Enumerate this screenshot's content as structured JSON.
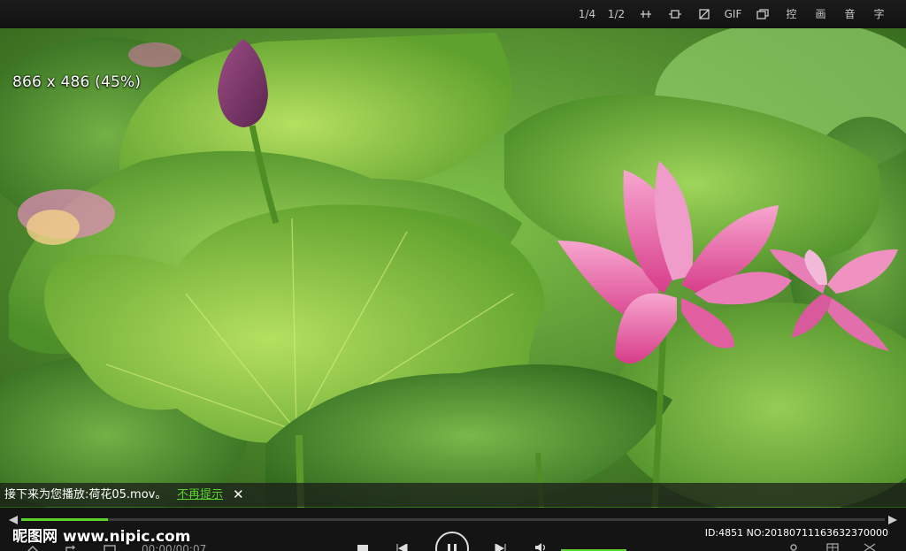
{
  "toolbar": {
    "items": [
      {
        "name": "quarter-size",
        "label": "1/4"
      },
      {
        "name": "half-size",
        "label": "1/2"
      },
      {
        "name": "crop-h",
        "label": ""
      },
      {
        "name": "crop-box",
        "label": ""
      },
      {
        "name": "rotate",
        "label": ""
      },
      {
        "name": "gif",
        "label": "GIF"
      },
      {
        "name": "windows",
        "label": ""
      },
      {
        "name": "control",
        "label": "控"
      },
      {
        "name": "picture",
        "label": "画"
      },
      {
        "name": "audio",
        "label": "音"
      },
      {
        "name": "subtitle",
        "label": "字"
      }
    ]
  },
  "video": {
    "resolution_label": "866 x 486 (45%)"
  },
  "notice": {
    "message": "接下来为您播放:荷花05.mov。",
    "dismiss_link": "不再提示",
    "close_glyph": "✕"
  },
  "bottom": {
    "watermark_brand": "昵图网",
    "watermark_url": "www.nipic.com",
    "image_id": "ID:4851 NO:20180711163632370000",
    "time": "00:00/00:07",
    "progress_fraction": 0.1,
    "colors": {
      "accent": "#5cd22c"
    }
  }
}
